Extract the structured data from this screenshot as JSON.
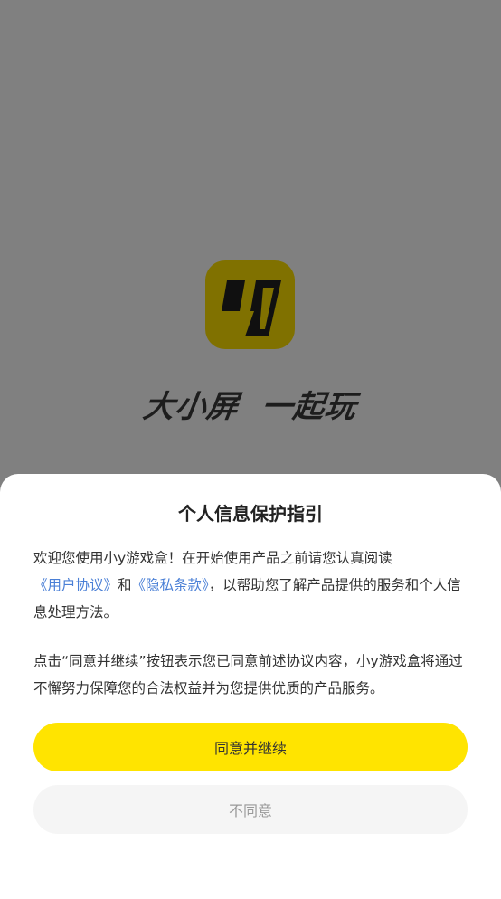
{
  "splash": {
    "logo_icon": "game-box-logo-icon",
    "slogan": "大小屏  一起玩"
  },
  "dialog": {
    "title": "个人信息保护指引",
    "para1": {
      "text_a": "欢迎您使用小y游戏盒！在开始使用产品之前请您认真阅读",
      "link_user_agreement": "《用户协议》",
      "text_b": "和",
      "link_privacy": "《隐私条款》",
      "text_c": "，以帮助您了解产品提供的服务和个人信息处理方法。"
    },
    "para2": "点击“同意并继续”按钮表示您已同意前述协议内容，小y游戏盒将通过不懈努力保障您的合法权益并为您提供优质的产品服务。",
    "agree_label": "同意并继续",
    "disagree_label": "不同意"
  },
  "colors": {
    "overlay": "#808080",
    "accent": "#ffe400",
    "link": "#4a7fd6",
    "logo_bg_dimmed": "#807100"
  }
}
